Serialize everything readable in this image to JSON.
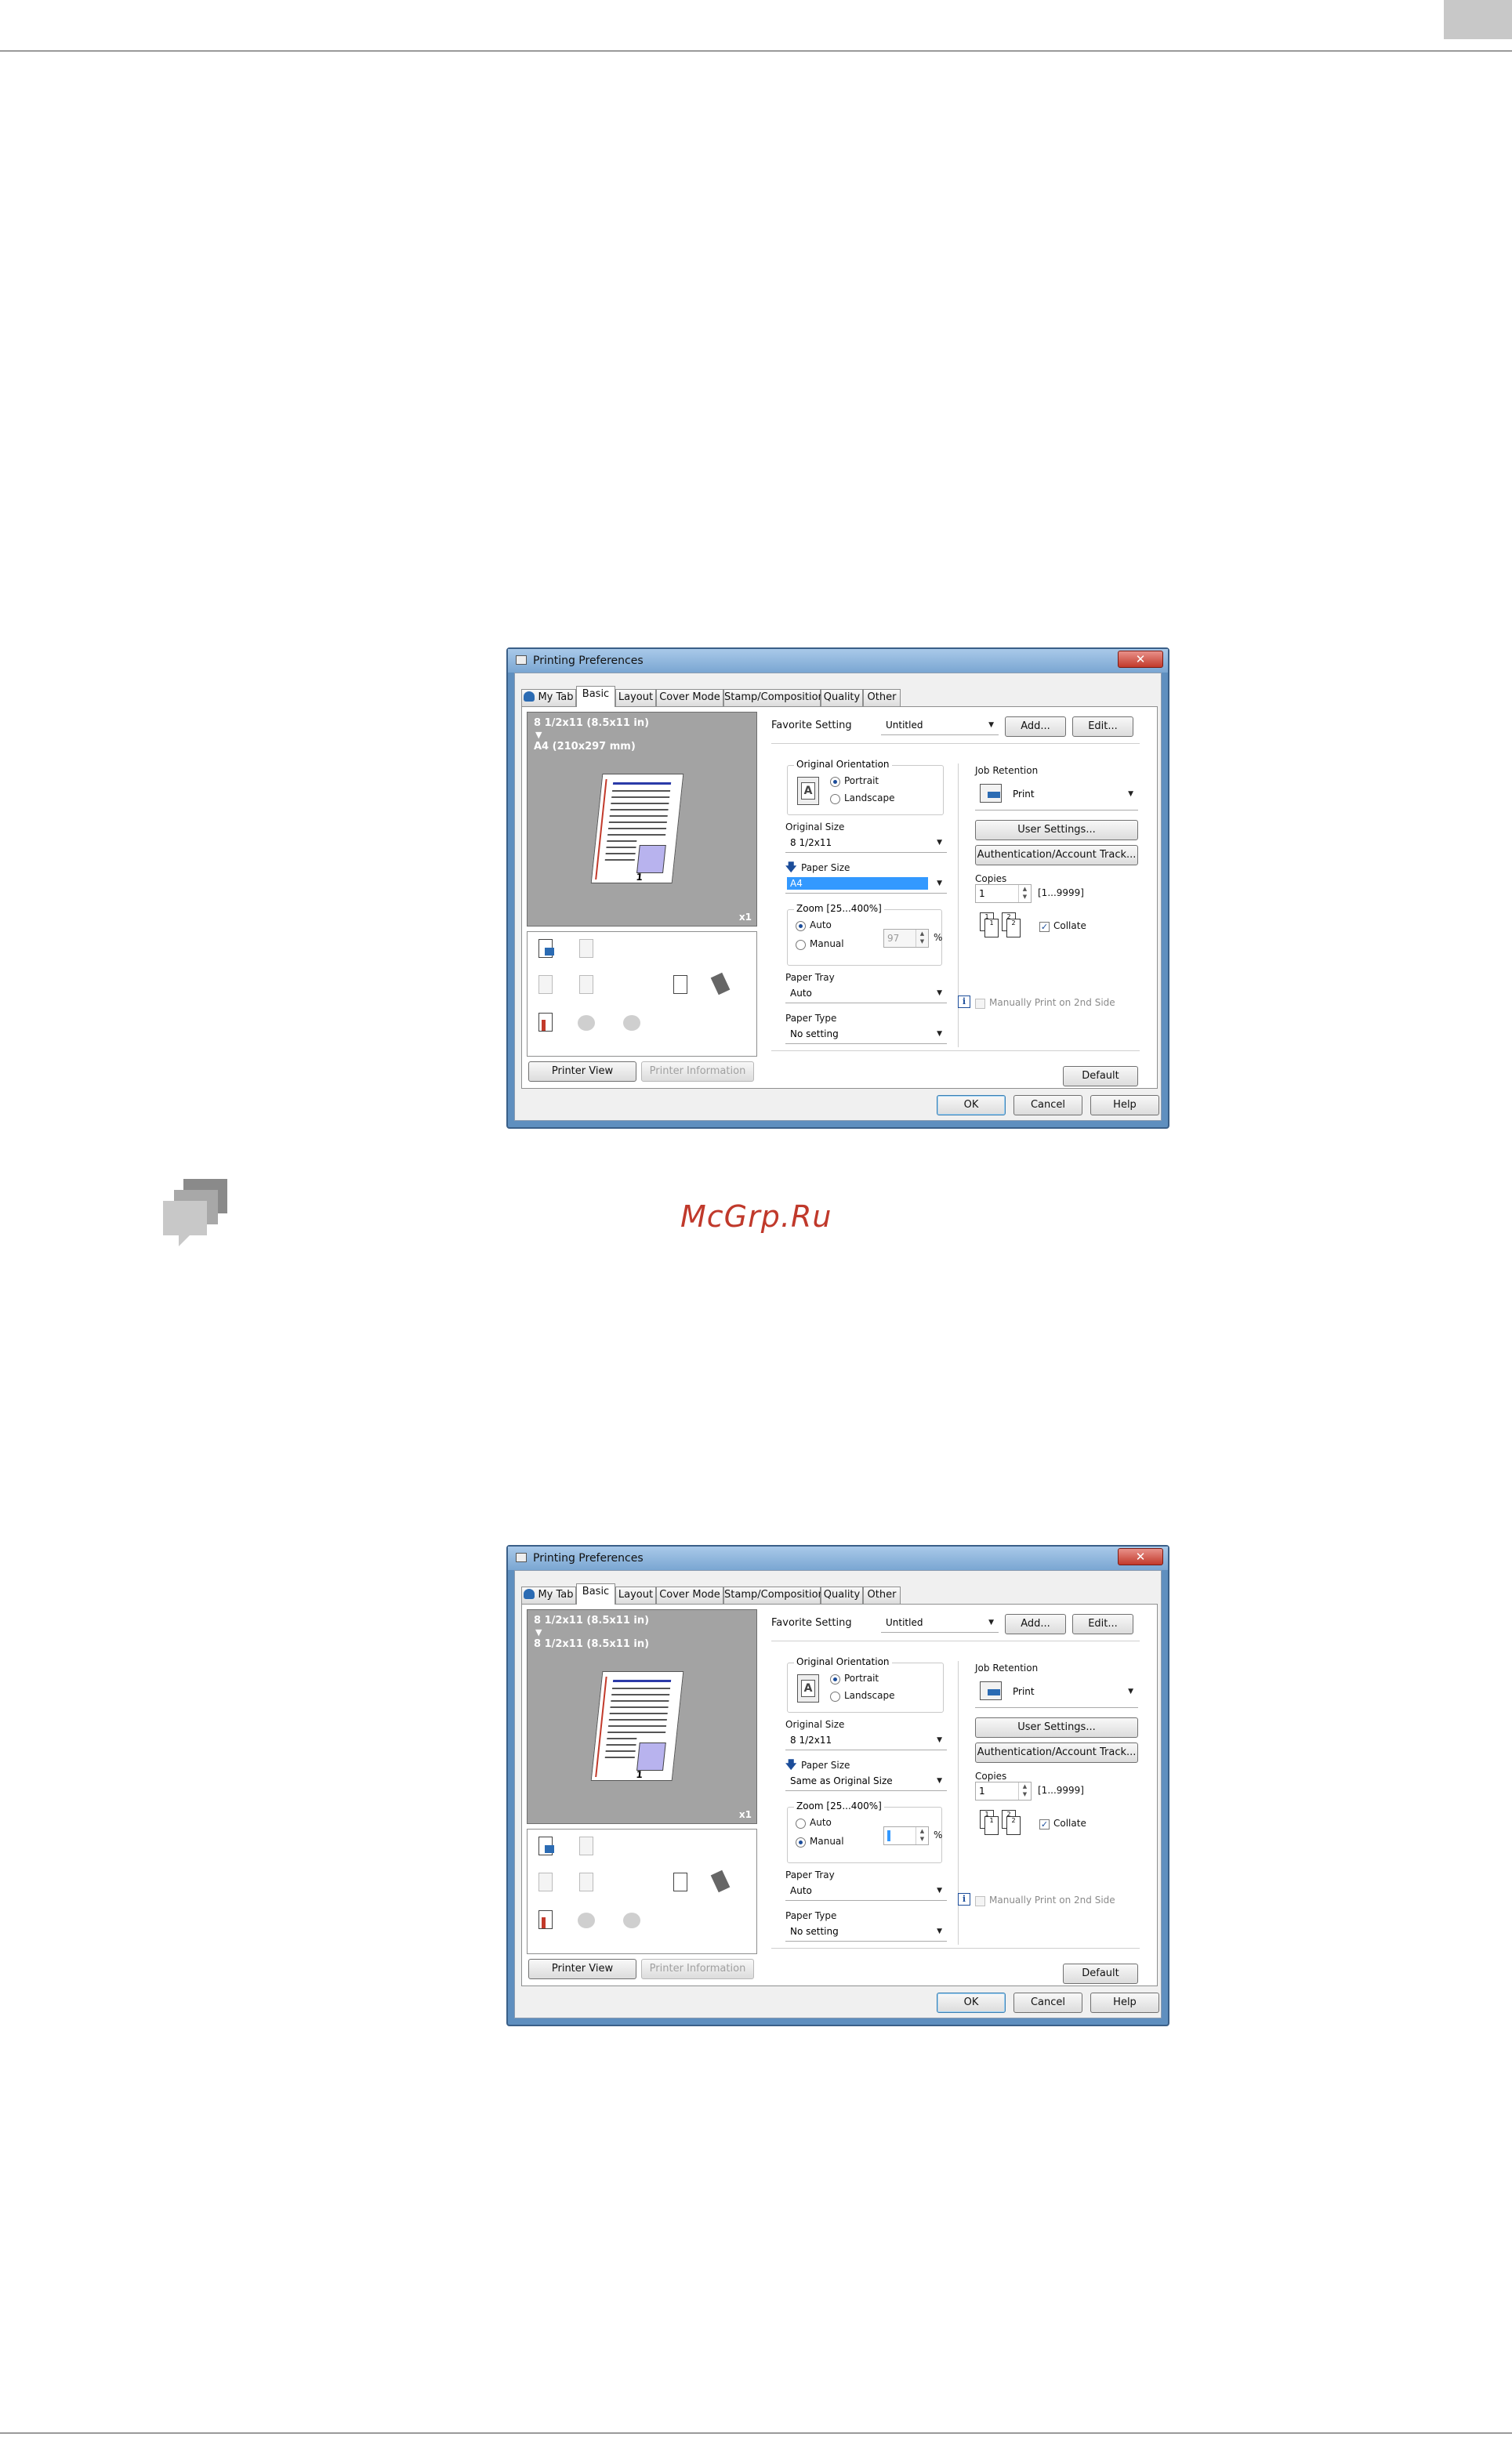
{
  "page": {
    "watermark": "McGrp.Ru"
  },
  "dialogs": [
    {
      "title": "Printing Preferences",
      "close": "✕",
      "tabs": [
        "My Tab",
        "Basic",
        "Layout",
        "Cover Mode",
        "Stamp/Composition",
        "Quality",
        "Other"
      ],
      "active_tab": "Basic",
      "preview": {
        "line1": "8 1/2x11 (8.5x11 in)",
        "arrow": "▼",
        "line2": "A4 (210x297 mm)",
        "multiplier": "x1",
        "page_number": "1"
      },
      "buttons": {
        "printer_view": "Printer View",
        "printer_information": "Printer Information",
        "add": "Add...",
        "edit": "Edit...",
        "user_settings": "User Settings...",
        "auth": "Authentication/Account Track...",
        "default": "Default",
        "ok": "OK",
        "cancel": "Cancel",
        "help": "Help"
      },
      "favorite_setting": {
        "label": "Favorite Setting",
        "value": "Untitled"
      },
      "orientation": {
        "title": "Original Orientation",
        "portrait": "Portrait",
        "landscape": "Landscape",
        "icon_letter": "A"
      },
      "original_size": {
        "label": "Original Size",
        "value": "8 1/2x11"
      },
      "paper_size": {
        "label": "Paper Size",
        "value": "A4",
        "selected": true
      },
      "zoom": {
        "title": "Zoom [25...400%]",
        "auto": "Auto",
        "manual": "Manual",
        "value": "97",
        "unit": "%",
        "mode": "auto"
      },
      "paper_tray": {
        "label": "Paper Tray",
        "value": "Auto"
      },
      "paper_type": {
        "label": "Paper Type",
        "value": "No setting"
      },
      "job_retention": {
        "label": "Job Retention",
        "value": "Print"
      },
      "copies": {
        "label": "Copies",
        "value": "1",
        "range": "[1...9999]"
      },
      "collate": {
        "label": "Collate",
        "checked": true
      },
      "manual_2nd_side": {
        "label": "Manually Print on 2nd Side",
        "checked": false
      }
    },
    {
      "title": "Printing Preferences",
      "close": "✕",
      "tabs": [
        "My Tab",
        "Basic",
        "Layout",
        "Cover Mode",
        "Stamp/Composition",
        "Quality",
        "Other"
      ],
      "active_tab": "Basic",
      "preview": {
        "line1": "8 1/2x11 (8.5x11 in)",
        "arrow": "▼",
        "line2": "8 1/2x11 (8.5x11 in)",
        "multiplier": "x1",
        "page_number": "1"
      },
      "buttons": {
        "printer_view": "Printer View",
        "printer_information": "Printer Information",
        "add": "Add...",
        "edit": "Edit...",
        "user_settings": "User Settings...",
        "auth": "Authentication/Account Track...",
        "default": "Default",
        "ok": "OK",
        "cancel": "Cancel",
        "help": "Help"
      },
      "favorite_setting": {
        "label": "Favorite Setting",
        "value": "Untitled"
      },
      "orientation": {
        "title": "Original Orientation",
        "portrait": "Portrait",
        "landscape": "Landscape",
        "icon_letter": "A"
      },
      "original_size": {
        "label": "Original Size",
        "value": "8 1/2x11"
      },
      "paper_size": {
        "label": "Paper Size",
        "value": "Same as Original Size",
        "selected": false
      },
      "zoom": {
        "title": "Zoom [25...400%]",
        "auto": "Auto",
        "manual": "Manual",
        "value": "",
        "unit": "%",
        "mode": "manual"
      },
      "paper_tray": {
        "label": "Paper Tray",
        "value": "Auto"
      },
      "paper_type": {
        "label": "Paper Type",
        "value": "No setting"
      },
      "job_retention": {
        "label": "Job Retention",
        "value": "Print"
      },
      "copies": {
        "label": "Copies",
        "value": "1",
        "range": "[1...9999]"
      },
      "collate": {
        "label": "Collate",
        "checked": true
      },
      "manual_2nd_side": {
        "label": "Manually Print on 2nd Side",
        "checked": false
      }
    }
  ]
}
